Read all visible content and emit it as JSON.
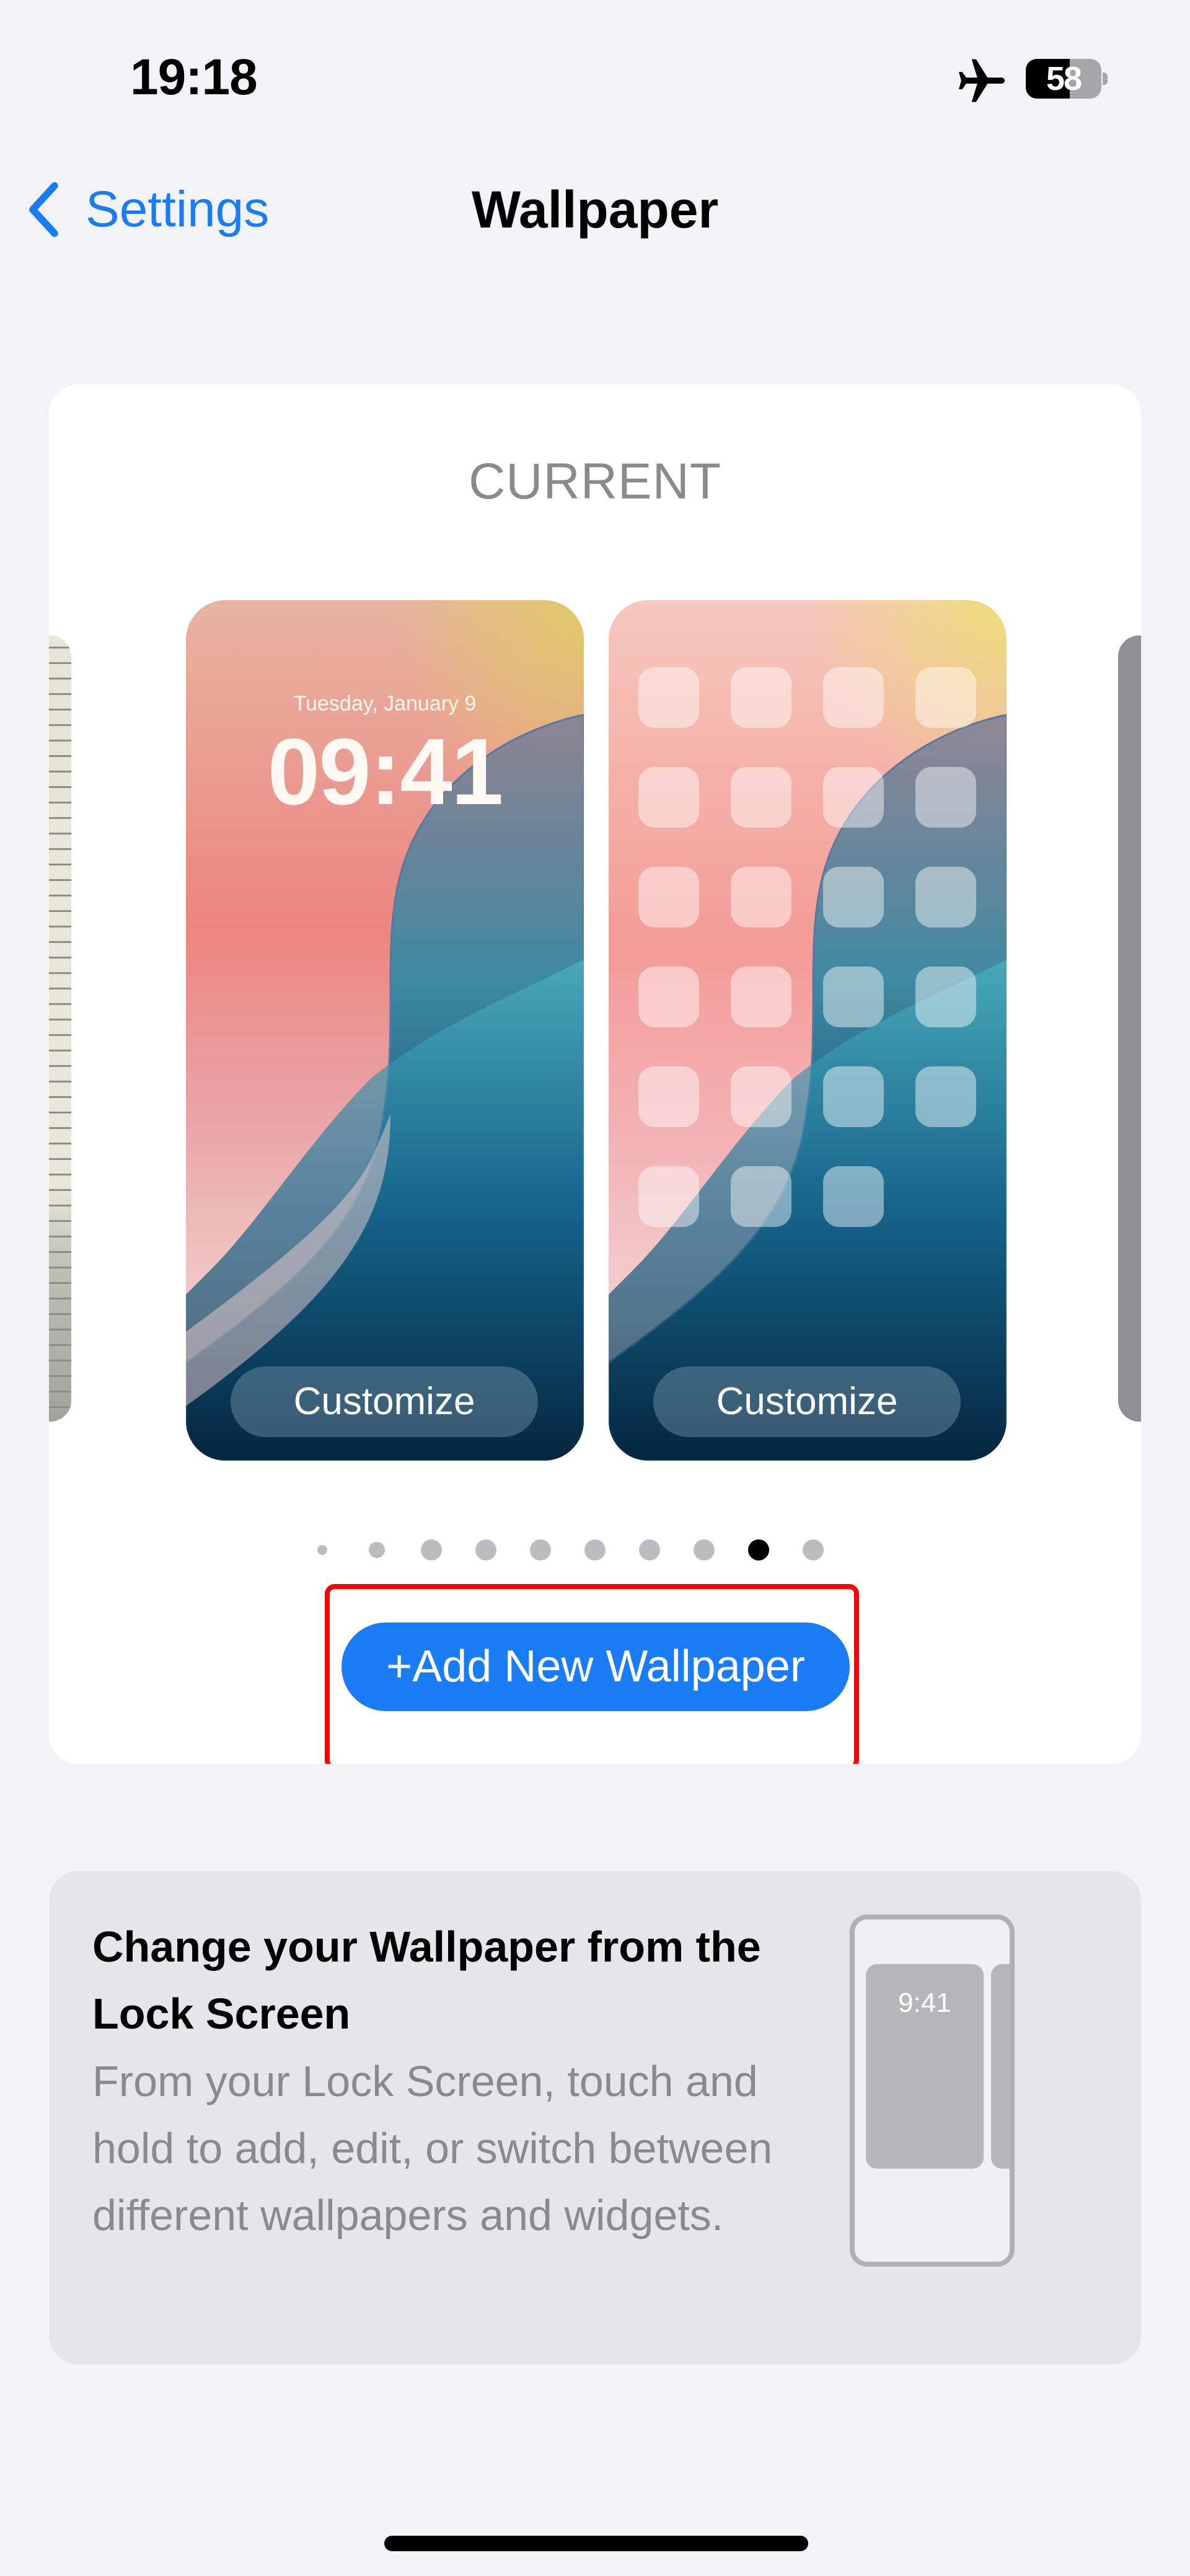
{
  "status_bar": {
    "time": "19:18",
    "airplane_mode_icon": "airplane-icon",
    "battery_percent": 58,
    "battery_label": "58"
  },
  "nav": {
    "back_label": "Settings",
    "back_icon": "chevron-left-icon",
    "title": "Wallpaper"
  },
  "wallpaper_card": {
    "section_label": "CURRENT",
    "lock_screen_preview": {
      "date": "Tuesday, January 9",
      "time": "09:41",
      "customize_label": "Customize"
    },
    "home_screen_preview": {
      "app_rows": [
        4,
        4,
        4,
        4,
        4,
        3
      ],
      "customize_label": "Customize"
    },
    "page_indicator": {
      "count": 10,
      "active_index": 8
    },
    "add_button_label": "+Add New Wallpaper"
  },
  "info_card": {
    "title": "Change your Wallpaper from the Lock Screen",
    "body": "From your Lock Screen, touch and hold to add, edit, or switch between different wallpapers and widgets.",
    "illustration_time": "9:41"
  },
  "colors": {
    "accent": "#1a7cf5",
    "background": "#f2f2f7",
    "highlight": "#ff0000",
    "secondary_text": "#8a8a8e"
  }
}
